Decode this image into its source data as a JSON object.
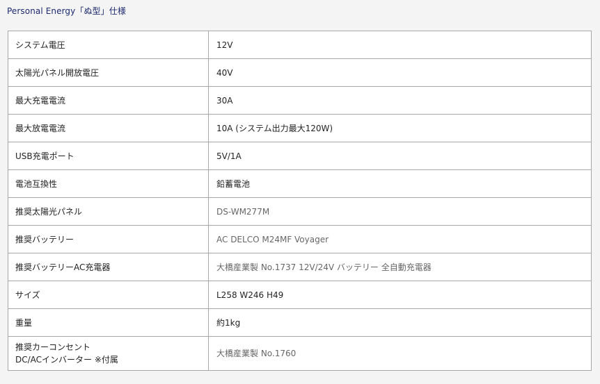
{
  "page_title": "Personal Energy「ぬ型」仕様",
  "spec_rows": [
    {
      "label": "システム電圧",
      "value": "12V"
    },
    {
      "label": "太陽光パネル開放電圧",
      "value": "40V"
    },
    {
      "label": "最大充電電流",
      "value": "30A"
    },
    {
      "label": "最大放電電流",
      "value": "10A (システム出力最大120W)"
    },
    {
      "label": "USB充電ポート",
      "value": "5V/1A"
    },
    {
      "label": "電池互換性",
      "value": "鉛蓄電池"
    },
    {
      "label": "推奨太陽光パネル",
      "value": "DS-WM277M"
    },
    {
      "label": "推奨バッテリー",
      "value": "AC DELCO M24MF Voyager"
    },
    {
      "label": "推奨バッテリーAC充電器",
      "value": "大橋産業製 No.1737 12V/24V バッテリー 全自動充電器"
    },
    {
      "label": "サイズ",
      "value": "L258 W246 H49"
    },
    {
      "label": "重量",
      "value": "約1kg"
    },
    {
      "label_line1": "推奨カーコンセント",
      "label_line2": "DC/ACインバーター ※付属",
      "value": "大橋産業製 No.1760"
    }
  ]
}
